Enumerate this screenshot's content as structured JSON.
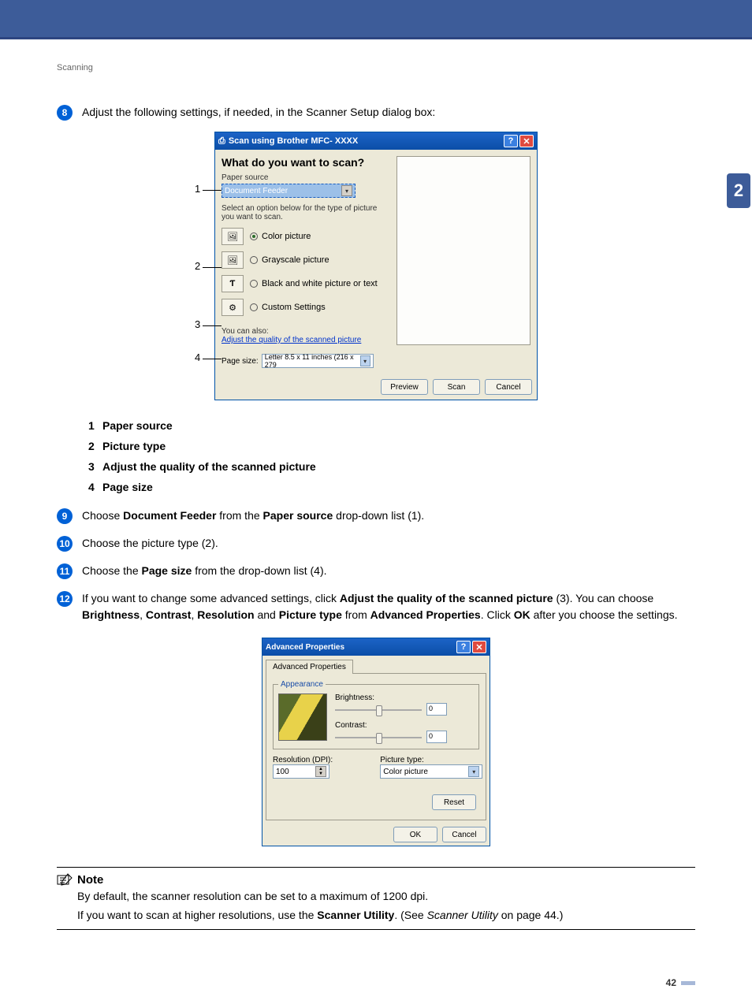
{
  "header": "Scanning",
  "side_tab": "2",
  "page_number": "42",
  "steps": {
    "s8": {
      "num": "8",
      "text": "Adjust the following settings, if needed, in the Scanner Setup dialog box:"
    },
    "s9": {
      "num": "9",
      "pre": "Choose ",
      "b1": "Document Feeder",
      "mid": " from the ",
      "b2": "Paper source",
      "post": " drop-down list (1)."
    },
    "s10": {
      "num": "10",
      "text": "Choose the picture type (2)."
    },
    "s11": {
      "num": "11",
      "pre": "Choose the ",
      "b1": "Page size",
      "post": " from the drop-down list (4)."
    },
    "s12": {
      "num": "12",
      "line1_pre": "If you want to change some advanced settings, click ",
      "line1_b": "Adjust the quality of the scanned picture",
      "line1_post": " (3). ",
      "line2_pre": "You can choose ",
      "b_brightness": "Brightness",
      "b_contrast": "Contrast",
      "b_resolution": "Resolution",
      "and": " and ",
      "b_pictype": "Picture type",
      "from": " from ",
      "b_adv": "Advanced Properties",
      "period": ". ",
      "line3_pre": "Click ",
      "b_ok": "OK",
      "line3_post": " after you choose the settings."
    }
  },
  "definitions": {
    "d1": {
      "num": "1",
      "label": "Paper source"
    },
    "d2": {
      "num": "2",
      "label": "Picture type"
    },
    "d3": {
      "num": "3",
      "label": "Adjust the quality of the scanned picture"
    },
    "d4": {
      "num": "4",
      "label": "Page size"
    }
  },
  "dialog1": {
    "title": "Scan using Brother MFC- XXXX",
    "question": "What do you want to scan?",
    "paper_source_label": "Paper source",
    "paper_source_value": "Document Feeder",
    "select_text": "Select an option below for the type of picture you want to scan.",
    "opt_color": "Color picture",
    "opt_gray": "Grayscale picture",
    "opt_bw": "Black and white picture or text",
    "opt_custom": "Custom Settings",
    "also_text": "You can also:",
    "adjust_link": "Adjust the quality of the scanned picture",
    "page_size_label": "Page size:",
    "page_size_value": "Letter 8.5 x 11 inches (216 x 279",
    "btn_preview": "Preview",
    "btn_scan": "Scan",
    "btn_cancel": "Cancel",
    "callouts": {
      "c1": "1",
      "c2": "2",
      "c3": "3",
      "c4": "4"
    }
  },
  "dialog2": {
    "title": "Advanced Properties",
    "tab": "Advanced Properties",
    "legend": "Appearance",
    "brightness_label": "Brightness:",
    "brightness_value": "0",
    "contrast_label": "Contrast:",
    "contrast_value": "0",
    "resolution_label": "Resolution (DPI):",
    "resolution_value": "100",
    "pictype_label": "Picture type:",
    "pictype_value": "Color picture",
    "btn_reset": "Reset",
    "btn_ok": "OK",
    "btn_cancel": "Cancel"
  },
  "note": {
    "heading": "Note",
    "line1": "By default, the scanner resolution can be set to a maximum of 1200 dpi.",
    "line2_pre": "If you want to scan at higher resolutions, use the ",
    "b_util": "Scanner Utility",
    "line2_mid": ". (See ",
    "i_util": "Scanner Utility",
    "line2_post": " on page 44.)"
  },
  "chart_data": {
    "type": "table",
    "title": "Advanced Properties values",
    "rows": [
      {
        "property": "Brightness",
        "value": 0
      },
      {
        "property": "Contrast",
        "value": 0
      },
      {
        "property": "Resolution (DPI)",
        "value": 100
      },
      {
        "property": "Picture type",
        "value": "Color picture"
      }
    ]
  }
}
